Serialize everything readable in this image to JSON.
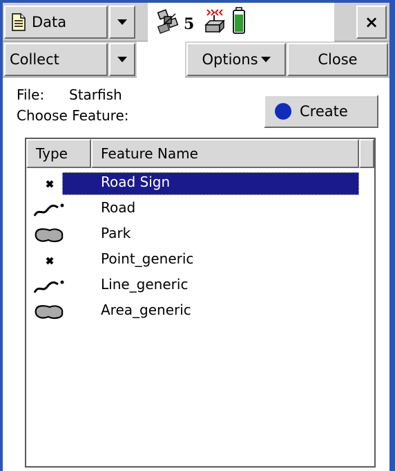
{
  "title_bar": {
    "app_label": "Data",
    "satellite_count": "5",
    "close_glyph": "×"
  },
  "toolbar": {
    "collect_label": "Collect",
    "options_label": "Options",
    "close_label": "Close"
  },
  "form": {
    "file_label": "File:",
    "file_value": "Starfish",
    "choose_label": "Choose Feature:",
    "create_label": "Create"
  },
  "list": {
    "columns": [
      "Type",
      "Feature Name"
    ],
    "rows": [
      {
        "name": "Road Sign",
        "icon": "point-icon",
        "selected": true
      },
      {
        "name": "Road",
        "icon": "line-icon",
        "selected": false
      },
      {
        "name": "Park",
        "icon": "area-icon",
        "selected": false
      },
      {
        "name": "Point_generic",
        "icon": "point-icon",
        "selected": false
      },
      {
        "name": "Line_generic",
        "icon": "line-icon",
        "selected": false
      },
      {
        "name": "Area_generic",
        "icon": "area-icon",
        "selected": false
      }
    ]
  },
  "colors": {
    "selection": "#1a1a8c",
    "create_dot": "#102cb8",
    "battery": "#2e9e2e",
    "frame": "#2a56b8"
  }
}
